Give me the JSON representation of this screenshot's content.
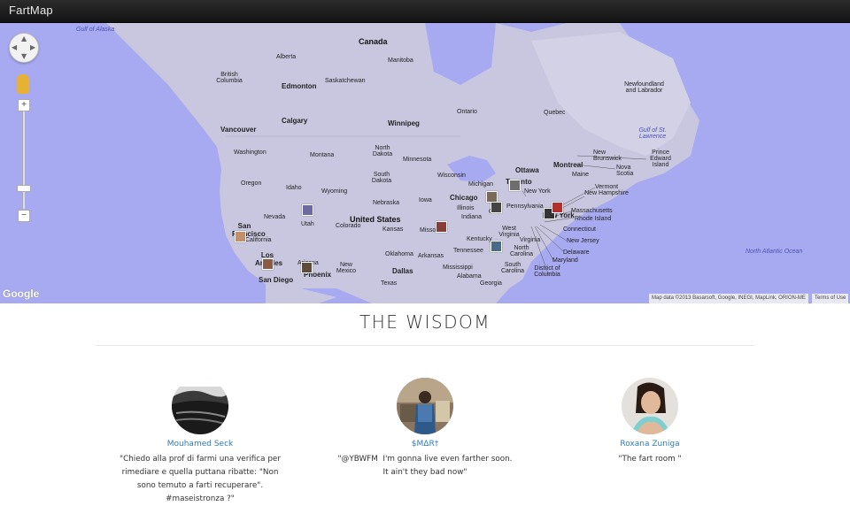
{
  "navbar": {
    "brand": "FartMap"
  },
  "map": {
    "labels": {
      "canada": "Canada",
      "united_states": "United States",
      "gulf_alaska": "Gulf of Alaska",
      "gulf_stlawrence": "Gulf of St. Lawrence",
      "north_atlantic": "North Atlantic Ocean",
      "alberta": "Alberta",
      "manitoba": "Manitoba",
      "british_columbia": "British Columbia",
      "edmonton": "Edmonton",
      "saskatchewan": "Saskatchewan",
      "calgary": "Calgary",
      "winnipeg": "Winnipeg",
      "ontario": "Ontario",
      "quebec": "Quebec",
      "newfoundland": "Newfoundland and Labrador",
      "vancouver": "Vancouver",
      "washington": "Washington",
      "montana": "Montana",
      "north_dakota": "North Dakota",
      "minnesota": "Minnesota",
      "ottawa": "Ottawa",
      "montreal": "Montreal",
      "maine": "Maine",
      "new_brunswick": "New Brunswick",
      "nova_scotia": "Nova Scotia",
      "pei": "Prince Edward Island",
      "oregon": "Oregon",
      "idaho": "Idaho",
      "wyoming": "Wyoming",
      "south_dakota": "South Dakota",
      "wisconsin": "Wisconsin",
      "michigan": "Michigan",
      "toronto": "Toronto",
      "new_york": "New York",
      "vermont": "Vermont",
      "new_hampshire": "New Hampshire",
      "massachusetts": "Massachusetts",
      "rhode_island": "Rhode Island",
      "connecticut": "Connecticut",
      "nebraska": "Nebraska",
      "iowa": "Iowa",
      "chicago": "Chicago",
      "ohio": "Ohio",
      "pennsylvania": "Pennsylvania",
      "nevada": "Nevada",
      "utah": "Utah",
      "colorado": "Colorado",
      "kansas": "Kansas",
      "missouri": "Missouri",
      "illinois": "Illinois",
      "indiana": "Indiana",
      "san_francisco": "San Francisco",
      "california": "California",
      "west_virginia": "West Virginia",
      "virginia": "Virginia",
      "kentucky": "Kentucky",
      "new_jersey": "New Jersey",
      "delaware": "Delaware",
      "maryland": "Maryland",
      "oklahoma": "Oklahoma",
      "arkansas": "Arkansas",
      "tennessee": "Tennessee",
      "north_carolina": "North Carolina",
      "los_angeles": "Los Angeles",
      "arizona": "Arizona",
      "new_mexico": "New Mexico",
      "phoenix": "Phoenix",
      "san_diego": "San Diego",
      "dallas": "Dallas",
      "mississippi": "Mississippi",
      "alabama": "Alabama",
      "south_carolina": "South Carolina",
      "georgia": "Georgia",
      "texas": "Texas",
      "dc": "District of Columbia",
      "new_york_short": "New York"
    },
    "zoom_in": "+",
    "zoom_out": "−",
    "google_logo": "Google",
    "attribution": "Map data ©2013 Basarsoft, Google, INEGI, MapLink, ORION-ME",
    "terms": "Terms of Use"
  },
  "wisdom": {
    "title": "THE WISDOM",
    "cards": [
      {
        "name": "Mouhamed Seck",
        "quote": "\"Chiedo alla prof di farmi una verifica per rimediare e quella puttana ribatte: \"Non sono temuto a farti recuperare\". #maseistronza ?\""
      },
      {
        "name": "$MΔR†",
        "quote": "\"@YBWFM ￼ I'm gonna live even farther soon. It ain't they bad now\""
      },
      {
        "name": "Roxana Zuniga",
        "quote": "\"The fart room ￼￼\""
      }
    ]
  }
}
